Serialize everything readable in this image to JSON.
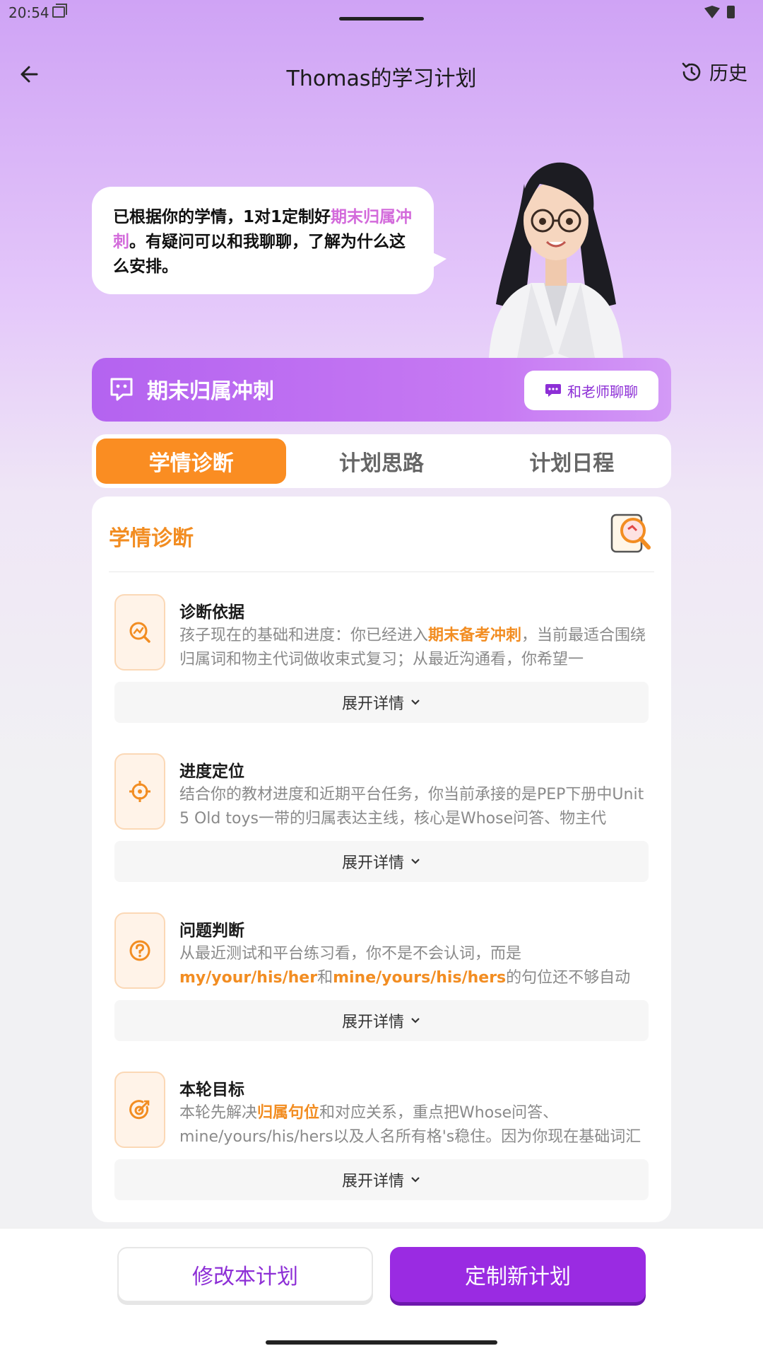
{
  "status": {
    "time": "20:54"
  },
  "header": {
    "title": "Thomas的学习计划",
    "history_label": "历史"
  },
  "bubble": {
    "text_before": "已根据你的学情，1对1定制好",
    "highlight": "期末归属冲刺",
    "text_after": "。有疑问可以和我聊聊，了解为什么这么安排。"
  },
  "banner": {
    "plan_name": "期末归属冲刺",
    "chat_button": "和老师聊聊"
  },
  "tabs": [
    {
      "label": "学情诊断",
      "active": true
    },
    {
      "label": "计划思路",
      "active": false
    },
    {
      "label": "计划日程",
      "active": false
    }
  ],
  "card": {
    "title": "学情诊断",
    "expand_label": "展开详情",
    "sections": [
      {
        "title": "诊断依据",
        "icon": "trend-search-icon",
        "p1": "孩子现在的基础和进度：你已经进入",
        "h1": "期末备考冲刺",
        "p2": "，当前最适合围绕归属词和物主代词做收束式复习；从最近沟通看，你希望一"
      },
      {
        "title": "进度定位",
        "icon": "crosshair-icon",
        "p1": "结合你的教材进度和近期平台任务，你当前承接的是PEP下册中Unit 5 Old toys一带的归属表达主线，核心是Whose问答、物主代"
      },
      {
        "title": "问题判断",
        "icon": "question-icon",
        "p1": "从最近测试和平台练习看，你不是不会认词，而是",
        "h1": "my/your/his/her",
        "p2": "和",
        "h2": "mine/yours/his/hers",
        "p3": "的句位还不够自动化，遇到Whose问句"
      },
      {
        "title": "本轮目标",
        "icon": "target-icon",
        "p1": "本轮先解决",
        "h1": "归属句位",
        "p2": "和对应关系，重点把Whose问答、mine/yours/his/hers以及人名所有格's稳住。因为你现在基础词汇和简"
      }
    ]
  },
  "footer": {
    "edit_label": "修改本计划",
    "new_label": "定制新计划"
  },
  "colors": {
    "accent_purple": "#9a2be2",
    "accent_orange": "#fa8d22",
    "highlight_pink": "#d36bdb"
  }
}
